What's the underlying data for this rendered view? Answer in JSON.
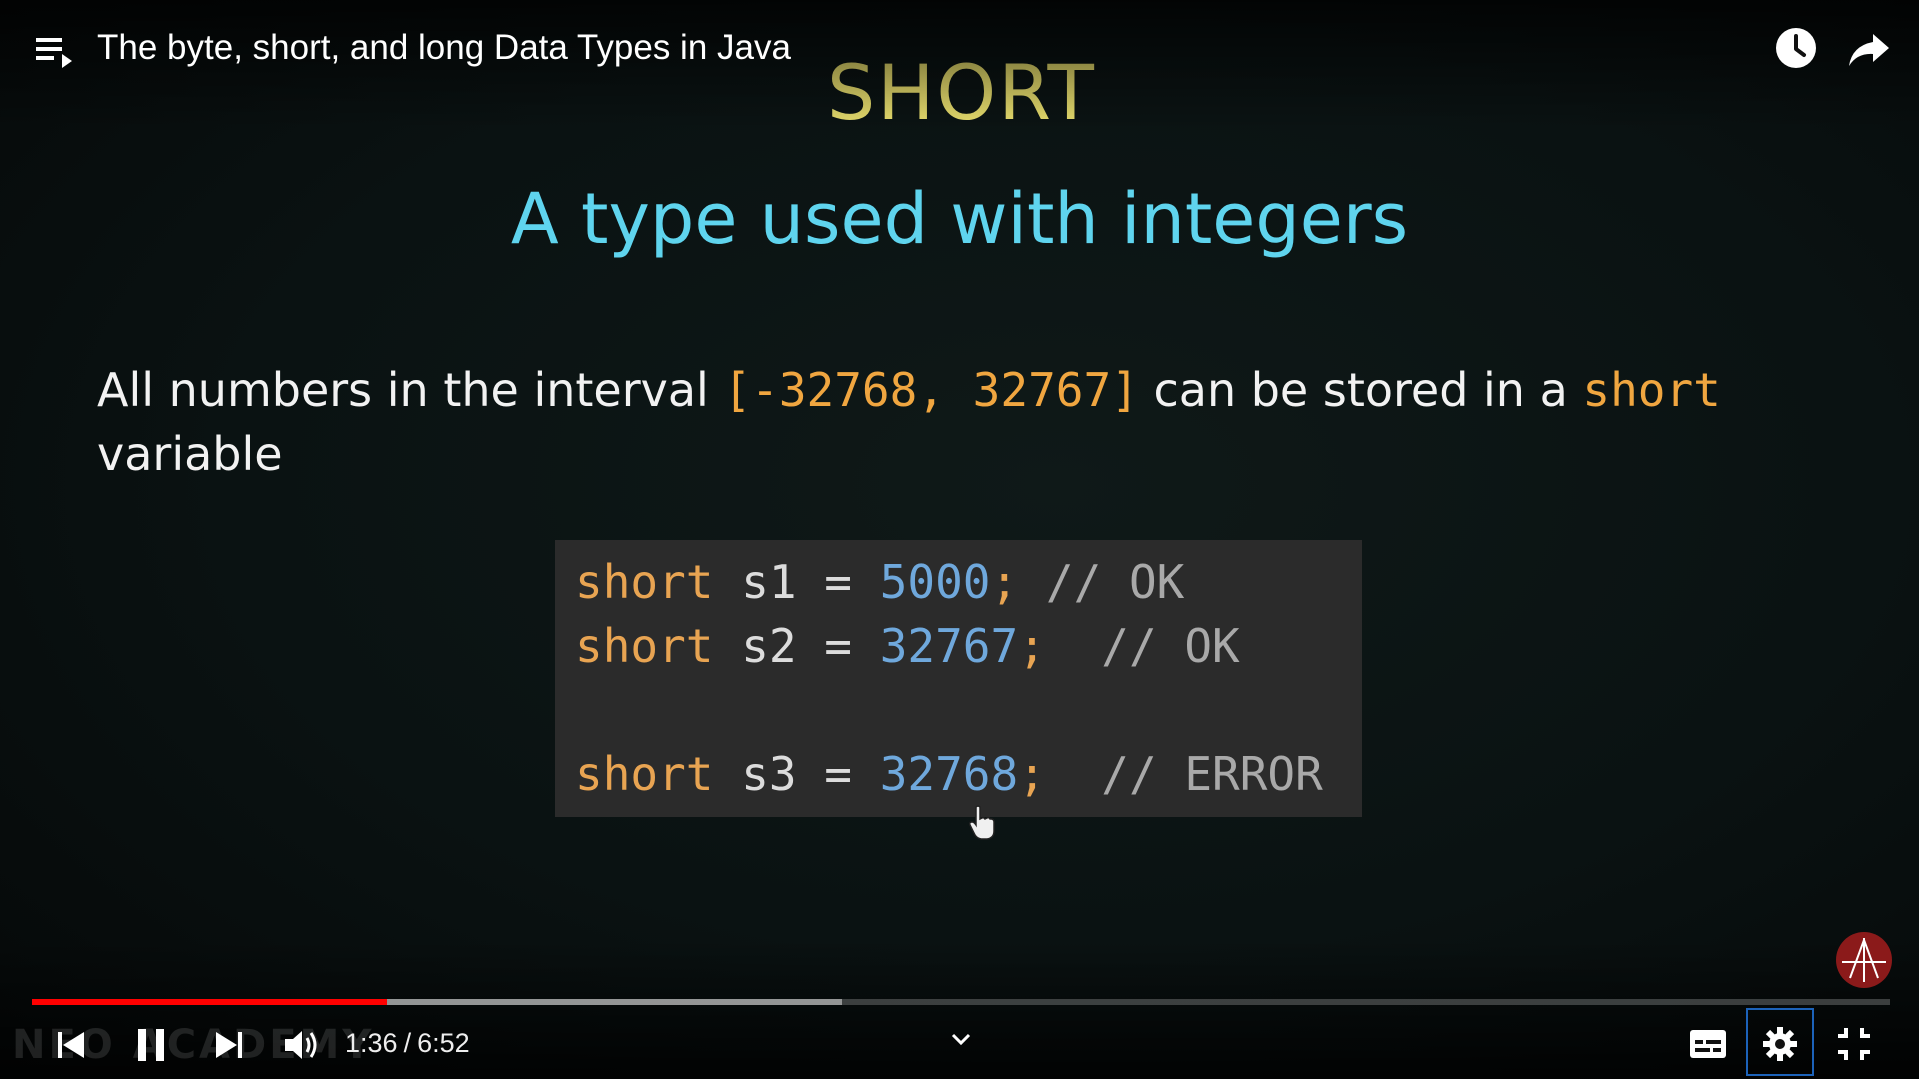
{
  "header": {
    "title": "The byte, short, and long Data Types in Java",
    "playlist_icon": "playlist-icon",
    "watch_later_icon": "clock-icon",
    "share_icon": "share-arrow-icon"
  },
  "slide": {
    "heading": "SHORT",
    "subheading": "A type used with integers",
    "text_before": "All numbers in the interval ",
    "range": "[-32768, 32767]",
    "text_middle": " can be stored in a ",
    "keyword": "short",
    "text_after": "variable",
    "code": [
      {
        "type": "short",
        "name": "s1",
        "eq": "=",
        "value": "5000",
        "semi": ";",
        "comment": "// OK"
      },
      {
        "type": "short",
        "name": "s2",
        "eq": "=",
        "value": "32767",
        "semi": ";",
        "comment": "// OK"
      },
      {
        "type": "short",
        "name": "s3",
        "eq": "=",
        "value": "32768",
        "semi": ";",
        "comment": "// ERROR"
      }
    ]
  },
  "watermark": {
    "text": "NEO ACADEMY"
  },
  "player": {
    "progress_fraction": 0.191,
    "buffered_fraction": 0.436,
    "current_time": "1:36",
    "time_separator": "/",
    "duration": "6:52",
    "colors": {
      "progress": "#ff0000",
      "settings_focus": "#1c62b9",
      "logo": "#8b1a1a"
    },
    "controls": {
      "previous_icon": "skip-previous-icon",
      "pause_icon": "pause-icon",
      "next_icon": "skip-next-icon",
      "volume_icon": "volume-icon",
      "chevron_icon": "chevron-down-icon",
      "subtitles_icon": "subtitles-icon",
      "settings_icon": "gear-icon",
      "exit_fullscreen_icon": "exit-fullscreen-icon"
    }
  }
}
